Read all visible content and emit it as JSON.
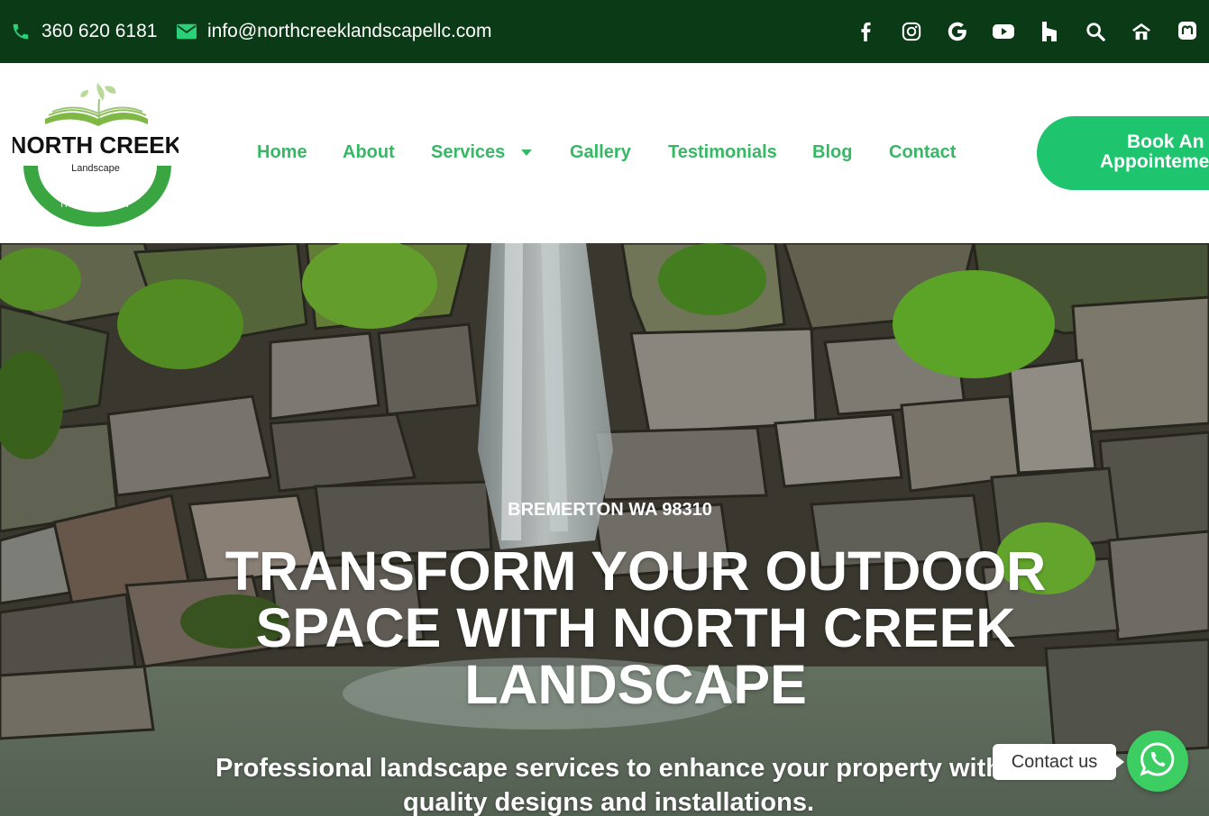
{
  "topbar": {
    "phone": "360 620 6181",
    "email": "info@northcreeklandscapellc.com",
    "phone_icon": "phone-icon",
    "email_icon": "envelope-icon",
    "socials": [
      "facebook-icon",
      "instagram-icon",
      "google-icon",
      "youtube-icon",
      "houzz-icon",
      "search-icon",
      "nextdoor-icon",
      "mastodon-icon"
    ]
  },
  "logo": {
    "name": "NORTH CREEK",
    "tagline": "Landscape",
    "ring_text": "IRRIGATION"
  },
  "nav": {
    "items": [
      {
        "label": "Home"
      },
      {
        "label": "About"
      },
      {
        "label": "Services"
      },
      {
        "label": "Gallery"
      },
      {
        "label": "Testimonials"
      },
      {
        "label": "Blog"
      },
      {
        "label": "Contact"
      }
    ],
    "cta_line1": "Book An",
    "cta_line2": "Appointeme"
  },
  "hero": {
    "location": "BREMERTON WA 98310",
    "headline": "TRANSFORM YOUR OUTDOOR SPACE WITH NORTH CREEK LANDSCAPE",
    "subheadline": "Professional landscape services to enhance your property with quality designs and installations."
  },
  "chat_widget": {
    "label": "Contact us",
    "icon": "whatsapp-icon"
  },
  "colors": {
    "topbar": "#0b3a16",
    "accent": "#36b865",
    "cta": "#1ec46e",
    "whatsapp": "#3ccd63"
  }
}
